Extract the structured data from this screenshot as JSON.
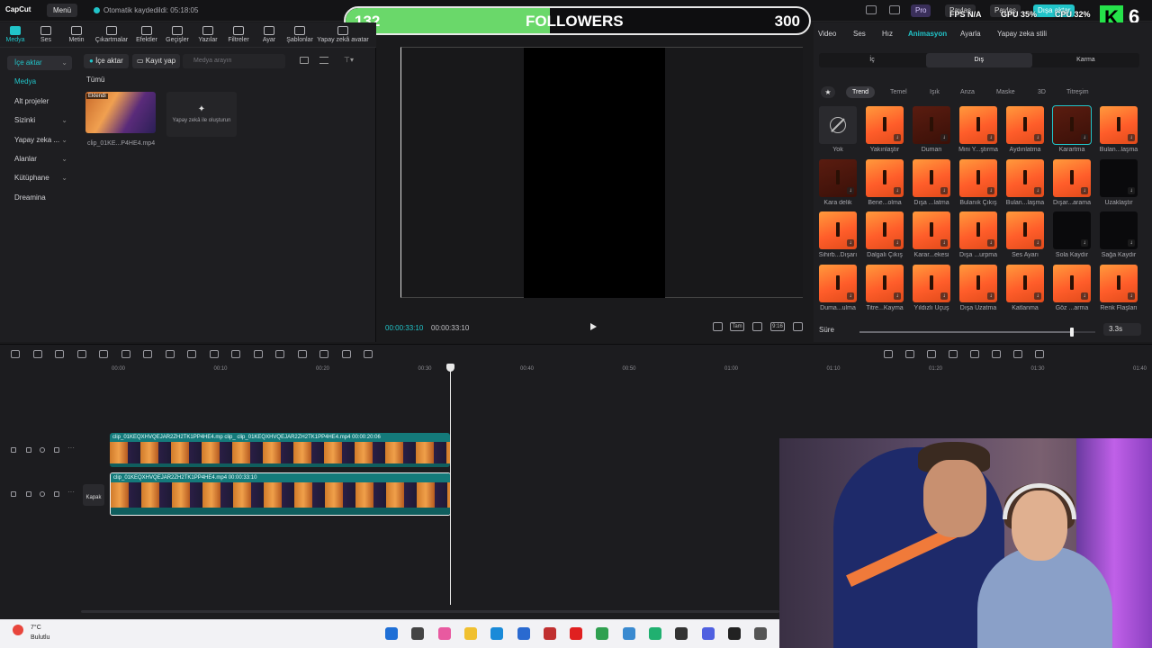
{
  "app": {
    "brand": "CapCut",
    "menu_label": "Menü",
    "autosave_text": "Otomatik kaydedildi: 05:18:05"
  },
  "topbar": {
    "pro_label": "Pro",
    "share1_label": "Paylaş",
    "share2_label": "Paylaş",
    "export_label": "Dışa aktar",
    "fps": "FPS N/A",
    "gpu": "GPU 35%",
    "cpu": "CPU 32%"
  },
  "overlay": {
    "current": "132",
    "label": "FOLLOWERS",
    "goal": "300",
    "progress": 0.44,
    "logo_letter": "K",
    "logo_num": "6"
  },
  "categories": [
    {
      "label": "Medya",
      "active": true
    },
    {
      "label": "Ses"
    },
    {
      "label": "Metin"
    },
    {
      "label": "Çıkartmalar"
    },
    {
      "label": "Efektler"
    },
    {
      "label": "Geçişler"
    },
    {
      "label": "Yazılar"
    },
    {
      "label": "Filtreler"
    },
    {
      "label": "Ayar"
    },
    {
      "label": "Şablonlar"
    },
    {
      "label": "Yapay zekâ avatar"
    }
  ],
  "sidebar": {
    "items": [
      {
        "label": "İçe aktar",
        "state": "sel",
        "chev": true
      },
      {
        "label": "Medya",
        "state": "hl"
      },
      {
        "label": "Alt projeler"
      },
      {
        "label": "Sizinki",
        "chev": true
      },
      {
        "label": "Yapay zeka ...",
        "chev": true
      },
      {
        "label": "Alanlar",
        "chev": true
      },
      {
        "label": "Kütüphane",
        "chev": true
      },
      {
        "label": "Dreamina"
      }
    ]
  },
  "media": {
    "import_label": "İçe aktar",
    "record_label": "Kayıt yap",
    "search_placeholder": "Medya arayın",
    "all_label": "Tümü",
    "thumb_badge": "Eklendi",
    "thumb_name": "clip_01KE...P4HE4.mp4",
    "ai_card": "Yapay zekâ ile oluşturun"
  },
  "preview": {
    "timecode_current": "00:00:33:10",
    "timecode_total": "00:00:33:10",
    "full_label": "Tam",
    "ratio_label": "9:16"
  },
  "right": {
    "tabs": [
      "Video",
      "Ses",
      "Hız",
      "Animasyon",
      "Ayarla",
      "Yapay zeka stili"
    ],
    "active_tab": "Animasyon",
    "segments": [
      "İç",
      "Dış",
      "Karma"
    ],
    "active_segment": "Dış",
    "chips": [
      "Trend",
      "Temel",
      "Işık",
      "Anza",
      "Maske",
      "3D",
      "Titreşim"
    ],
    "active_chip": "Trend",
    "effects": [
      "Yok",
      "Yakınlaştır",
      "Duman",
      "Mini Y...ştırma",
      "Aydınlatma",
      "Karartma",
      "Bulan...laşma",
      "Kara delik",
      "Bene...olma",
      "Dışa ...latma",
      "Bulanık Çıkış",
      "Bulan...laşma",
      "Dışar...arama",
      "Uzaklaştır",
      "Sihirb...Dışarı",
      "Dalgalı Çıkış",
      "Karar...ekesi",
      "Dışa ...urpma",
      "Ses Ayarı",
      "Sola Kaydır",
      "Sağa Kaydır",
      "Duma...ulma",
      "Titre...Kayma",
      "Yıldızlı Uçuş",
      "Dışa Uzatma",
      "Katlanma",
      "Göz ...arma",
      "Renk Flaşları"
    ],
    "duration_label": "Süre",
    "duration_value": "3.3s",
    "duration_fraction": 0.9
  },
  "timeline": {
    "ticks": [
      "00:00",
      "00:10",
      "00:20",
      "00:30",
      "00:40",
      "00:50",
      "01:00",
      "01:10",
      "01:20",
      "01:30",
      "01:40"
    ],
    "track1_header": "clip_01KEQXHVQEJAR2ZH2TK1PP4HE4.mp  clip_  clip_01KEQXHVQEJAR2ZH2TK1PP4HE4.mp4   00:00:20:06",
    "track2_header": "clip_01KEQXHVQEJAR2ZH2TK1PP4HE4.mp4   00:00:33:10",
    "cover_label": "Kapak"
  },
  "taskbar": {
    "temp": "7°C",
    "weather": "Bulutlu"
  },
  "colors": {
    "accent": "#21c4c9",
    "overlay_fill": "#6ad86a",
    "logo": "#25e24a"
  }
}
